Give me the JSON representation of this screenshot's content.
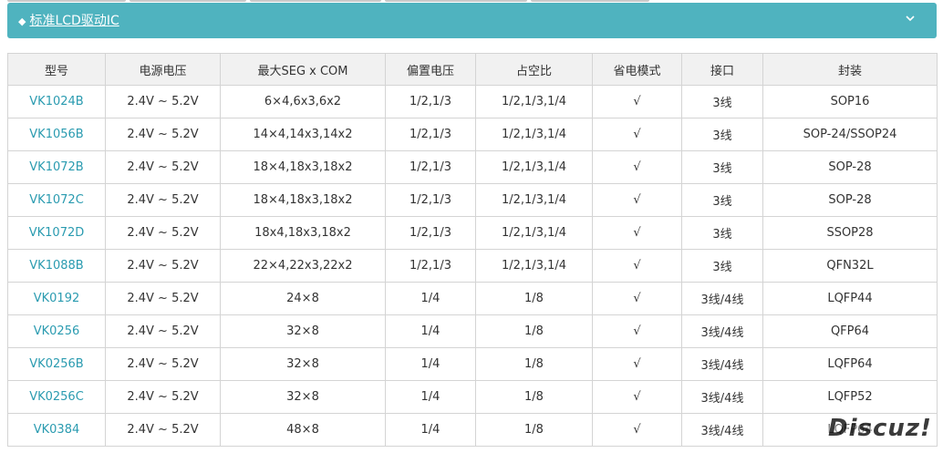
{
  "header": {
    "bullet": "◆",
    "title": "标准LCD驱动IC",
    "chevron_icon": "chevron-down-icon"
  },
  "table": {
    "columns": [
      "型号",
      "电源电压",
      "最大SEG x COM",
      "偏置电压",
      "占空比",
      "省电模式",
      "接口",
      "封装"
    ],
    "rows": [
      [
        "VK1024B",
        "2.4V ~ 5.2V",
        "6×4,6x3,6x2",
        "1/2,1/3",
        "1/2,1/3,1/4",
        "√",
        "3线",
        "SOP16"
      ],
      [
        "VK1056B",
        "2.4V ~ 5.2V",
        "14×4,14x3,14x2",
        "1/2,1/3",
        "1/2,1/3,1/4",
        "√",
        "3线",
        "SOP-24/SSOP24"
      ],
      [
        "VK1072B",
        "2.4V ~ 5.2V",
        "18×4,18x3,18x2",
        "1/2,1/3",
        "1/2,1/3,1/4",
        "√",
        "3线",
        "SOP-28"
      ],
      [
        "VK1072C",
        "2.4V ~ 5.2V",
        "18×4,18x3,18x2",
        "1/2,1/3",
        "1/2,1/3,1/4",
        "√",
        "3线",
        "SOP-28"
      ],
      [
        "VK1072D",
        "2.4V ~ 5.2V",
        "18x4,18x3,18x2",
        "1/2,1/3",
        "1/2,1/3,1/4",
        "√",
        "3线",
        "SSOP28"
      ],
      [
        "VK1088B",
        "2.4V ~ 5.2V",
        "22×4,22x3,22x2",
        "1/2,1/3",
        "1/2,1/3,1/4",
        "√",
        "3线",
        "QFN32L"
      ],
      [
        "VK0192",
        "2.4V ~ 5.2V",
        "24×8",
        "1/4",
        "1/8",
        "√",
        "3线/4线",
        "LQFP44"
      ],
      [
        "VK0256",
        "2.4V ~ 5.2V",
        "32×8",
        "1/4",
        "1/8",
        "√",
        "3线/4线",
        "QFP64"
      ],
      [
        "VK0256B",
        "2.4V ~ 5.2V",
        "32×8",
        "1/4",
        "1/8",
        "√",
        "3线/4线",
        "LQFP64"
      ],
      [
        "VK0256C",
        "2.4V ~ 5.2V",
        "32×8",
        "1/4",
        "1/8",
        "√",
        "3线/4线",
        "LQFP52"
      ],
      [
        "VK0384",
        "2.4V ~ 5.2V",
        "48×8",
        "1/4",
        "1/8",
        "√",
        "3线/4线",
        "LQFP64"
      ]
    ]
  },
  "watermark": "Discuz!",
  "colors": {
    "header_bg": "#4fb3bf",
    "link": "#2a9bb0",
    "th_bg": "#f1f1f1",
    "border": "#d4d4d4"
  }
}
